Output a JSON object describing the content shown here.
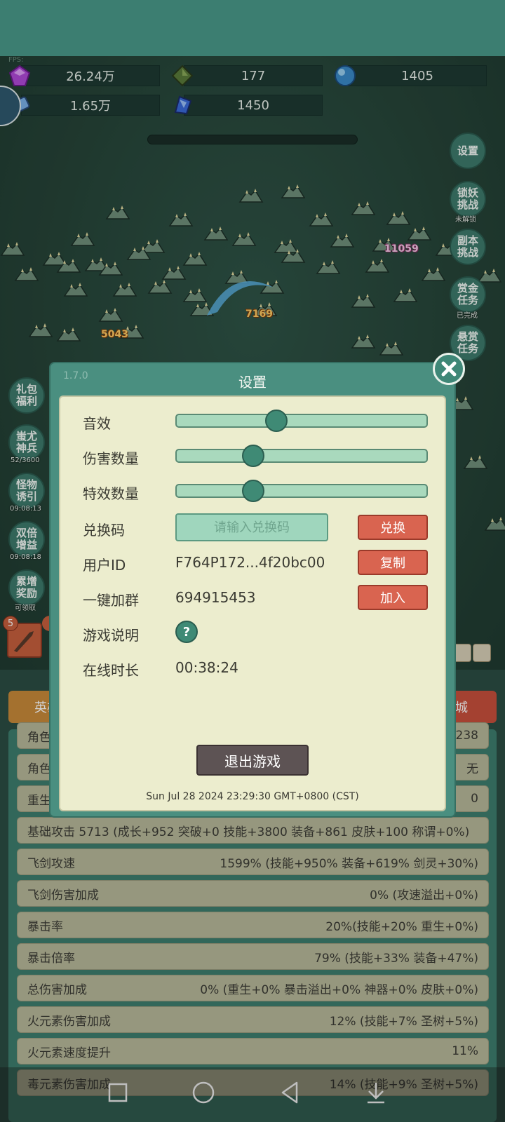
{
  "hud": {
    "fps_label": "FPS:",
    "resources": [
      {
        "icon": "purple-gem-icon",
        "value": "26.24万"
      },
      {
        "icon": "green-crystal-icon",
        "value": "177"
      },
      {
        "icon": "blue-orb-icon",
        "value": "1405"
      },
      {
        "icon": "scroll-icon",
        "value": "1.65万"
      },
      {
        "icon": "blue-shard-icon",
        "value": "1450"
      }
    ]
  },
  "side_right": [
    {
      "label": "设置",
      "tag": ""
    },
    {
      "label": "锁妖挑战",
      "tag": "未解锁"
    },
    {
      "label": "副本挑战",
      "tag": ""
    },
    {
      "label": "赏金任务",
      "tag": "已完成"
    },
    {
      "label": "悬赏任务",
      "tag": ""
    }
  ],
  "side_left": [
    {
      "label": "礼包福利",
      "tag": ""
    },
    {
      "label": "蚩尤神兵",
      "tag": "52/3600"
    },
    {
      "label": "怪物诱引",
      "tag": "09:08:13"
    },
    {
      "label": "双倍增益",
      "tag": "09:08:18"
    },
    {
      "label": "累增奖励",
      "tag": "可领取"
    }
  ],
  "damage_numbers": [
    "11059",
    "7169",
    "5043"
  ],
  "skill_slot_badge": "5",
  "lower": {
    "tab_hero": "英雄",
    "tab_shop": "商城",
    "stats": [
      {
        "label": "角色",
        "value": "238"
      },
      {
        "label": "角色",
        "value": "无"
      },
      {
        "label": "重生次数",
        "value": "0"
      },
      {
        "label": "基础攻击 5713 (成长+952 突破+0 技能+3800 装备+861 皮肤+100 称谓+0%)",
        "value": ""
      },
      {
        "label": "飞剑攻速",
        "value": "1599% (技能+950% 装备+619% 剑灵+30%)"
      },
      {
        "label": "飞剑伤害加成",
        "value": "0% (攻速溢出+0%)"
      },
      {
        "label": "暴击率",
        "value": "20%(技能+20% 重生+0%)"
      },
      {
        "label": "暴击倍率",
        "value": "79% (技能+33% 装备+47%)"
      },
      {
        "label": "总伤害加成",
        "value": "0% (重生+0% 暴击溢出+0% 神器+0% 皮肤+0%)"
      },
      {
        "label": "火元素伤害加成",
        "value": "12% (技能+7% 圣树+5%)"
      },
      {
        "label": "火元素速度提升",
        "value": "11%"
      },
      {
        "label": "毒元素伤害加成",
        "value": "14% (技能+9% 圣树+5%)"
      }
    ]
  },
  "dialog": {
    "version": "1.7.0",
    "title": "设置",
    "sound_label": "音效",
    "sound_level": 0.39,
    "damage_count_label": "伤害数量",
    "damage_count_level": 0.29,
    "effect_count_label": "特效数量",
    "effect_count_level": 0.29,
    "redeem_label": "兑换码",
    "redeem_placeholder": "请输入兑换码",
    "redeem_value": "",
    "redeem_button": "兑换",
    "user_id_label": "用户ID",
    "user_id_value": "F764P172...4f20bc00",
    "copy_button": "复制",
    "group_label": "一键加群",
    "group_value": "694915453",
    "join_button": "加入",
    "guide_label": "游戏说明",
    "guide_icon": "question-icon",
    "online_label": "在线时长",
    "online_value": "00:38:24",
    "exit_button": "退出游戏",
    "timestamp": "Sun Jul 28 2024 23:29:30 GMT+0800 (CST)"
  },
  "colors": {
    "teal": "#4a9a8a",
    "panel_bg": "#ecedce",
    "red_button": "#d96450",
    "dark_button": "#5d5354"
  }
}
